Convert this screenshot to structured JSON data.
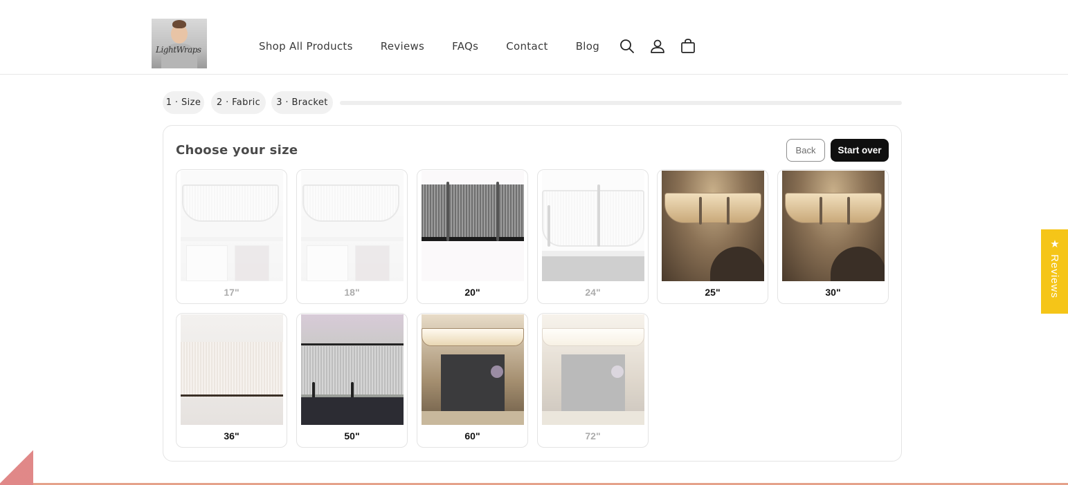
{
  "header": {
    "logo_text": "LightWraps",
    "nav": [
      "Shop All Products",
      "Reviews",
      "FAQs",
      "Contact",
      "Blog"
    ],
    "icons": [
      "search-icon",
      "account-icon",
      "cart-icon"
    ]
  },
  "steps": {
    "items": [
      "1 · Size",
      "2 · Fabric",
      "3 · Bracket"
    ],
    "progress": 0
  },
  "panel": {
    "title": "Choose your size",
    "back_label": "Back",
    "start_over_label": "Start over"
  },
  "sizes": [
    {
      "label": "17\"",
      "available": false
    },
    {
      "label": "18\"",
      "available": false
    },
    {
      "label": "20\"",
      "available": true
    },
    {
      "label": "24\"",
      "available": false
    },
    {
      "label": "25\"",
      "available": true
    },
    {
      "label": "30\"",
      "available": true
    },
    {
      "label": "36\"",
      "available": true
    },
    {
      "label": "50\"",
      "available": true
    },
    {
      "label": "60\"",
      "available": true
    },
    {
      "label": "72\"",
      "available": false
    }
  ],
  "reviews_tab": "★ Reviews",
  "colors": {
    "accent": "#0f0f0f",
    "reviews_tab": "#f5c518"
  }
}
